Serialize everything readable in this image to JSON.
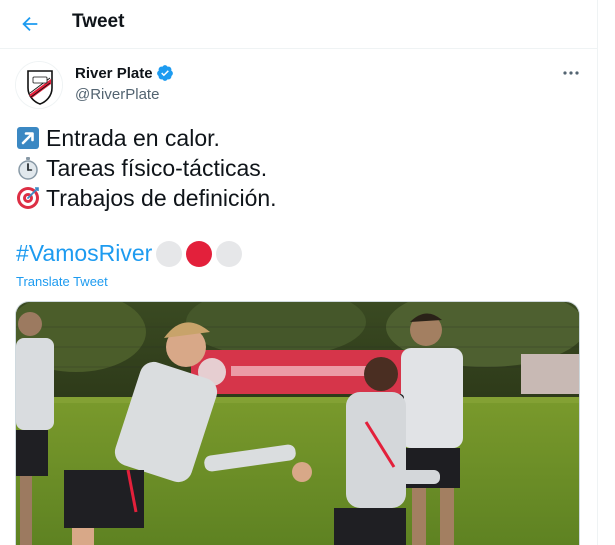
{
  "header": {
    "title": "Tweet"
  },
  "tweet": {
    "author": {
      "display_name": "River Plate",
      "handle": "@RiverPlate",
      "verified": true
    },
    "lines": [
      {
        "emoji": "arrow-up-right",
        "text": "Entrada en calor."
      },
      {
        "emoji": "stopwatch",
        "text": "Tareas físico-tácticas."
      },
      {
        "emoji": "direct-hit-target",
        "text": "Trabajos de definición."
      }
    ],
    "hashtag": "#VamosRiver",
    "hashtag_circles": [
      "#e6e7e9",
      "#e3203b",
      "#e6e7e9"
    ],
    "translate_label": "Translate Tweet",
    "media_alt": "River Plate players training on the field"
  },
  "colors": {
    "link": "#1d9bf0",
    "text": "#0f1419",
    "secondary": "#536471",
    "border": "#eff3f4",
    "river_red": "#e3203b"
  }
}
